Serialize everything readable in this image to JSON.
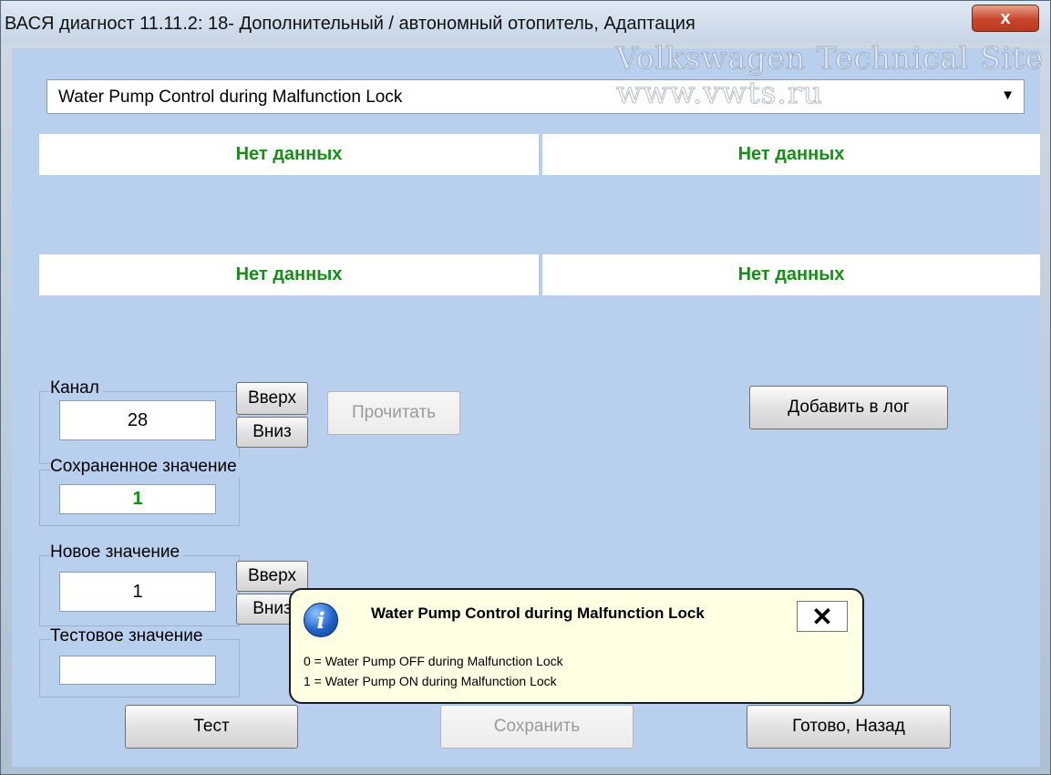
{
  "window": {
    "title": "ВАСЯ диагност 11.11.2: 18- Дополнительный / автономный отопитель, Адаптация",
    "close_glyph": "x"
  },
  "watermark": {
    "line1": "Volkswagen Technical Site",
    "line2": "www.vwts.ru"
  },
  "measurement": {
    "selected": "Water Pump Control during Malfunction Lock",
    "arrow_glyph": "▼"
  },
  "data_cells": [
    "Нет данных",
    "Нет данных",
    "Нет данных",
    "Нет данных"
  ],
  "channel": {
    "label": "Канал",
    "value": "28",
    "up_label": "Вверх",
    "down_label": "Вниз",
    "read_label": "Прочитать"
  },
  "add_log_label": "Добавить в лог",
  "saved": {
    "label": "Сохраненное значение",
    "value": "1"
  },
  "new_value": {
    "label": "Новое значение",
    "value": "1",
    "up_label": "Вверх",
    "down_label": "Вниз"
  },
  "test_value": {
    "label": "Тестовое значение",
    "value": ""
  },
  "buttons": {
    "test": "Тест",
    "save": "Сохранить",
    "done": "Готово, Назад"
  },
  "tooltip": {
    "icon_glyph": "i",
    "title": "Water Pump Control during Malfunction Lock",
    "close_glyph": "✕",
    "lines": [
      "0 = Water Pump OFF during Malfunction Lock",
      "1 = Water Pump ON during Malfunction Lock"
    ]
  }
}
